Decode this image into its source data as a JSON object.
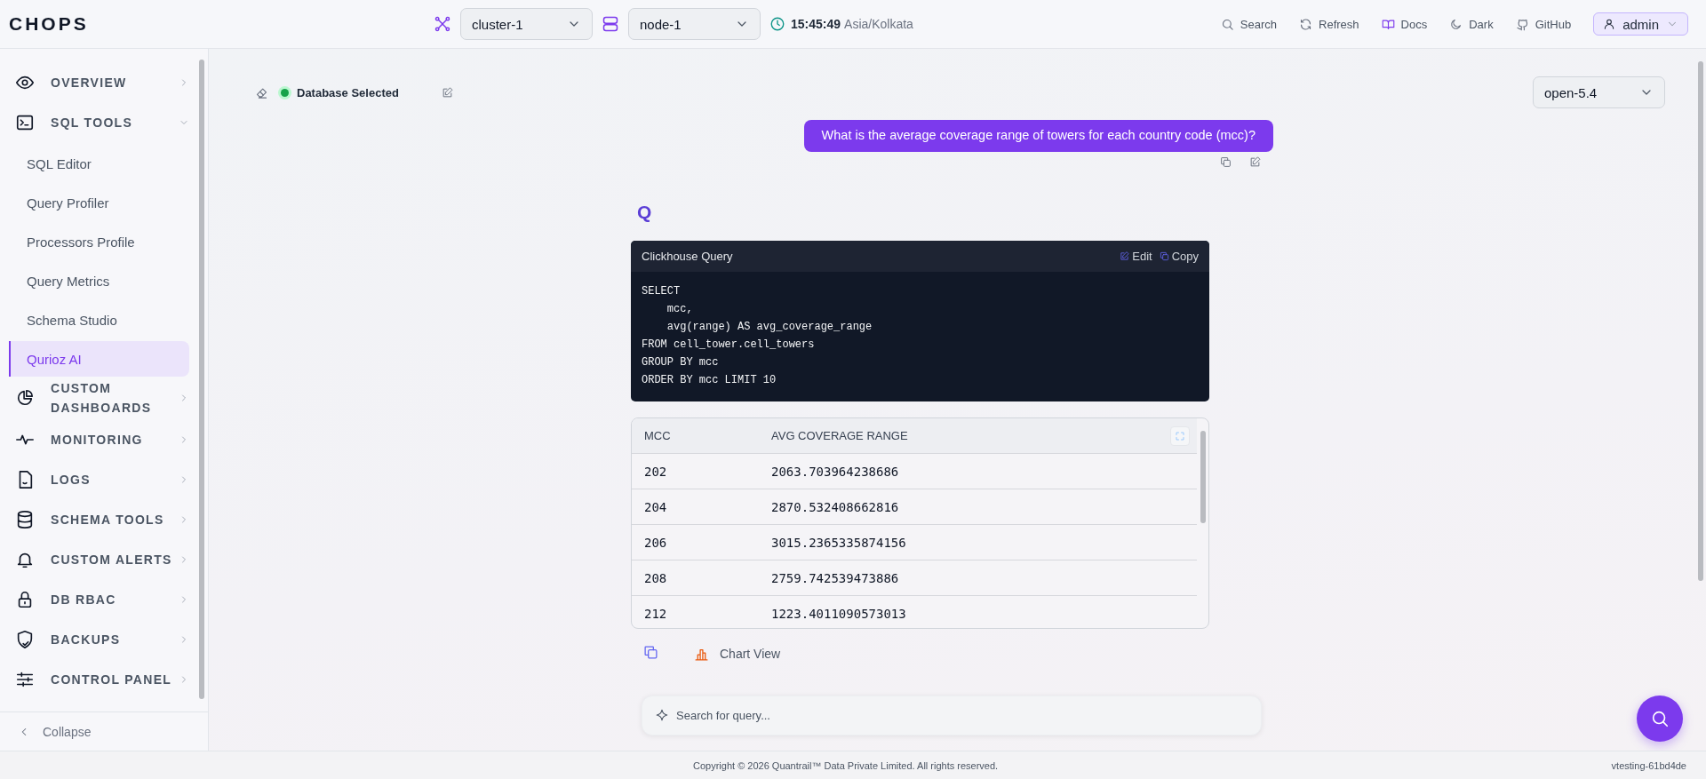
{
  "header": {
    "logo": "CHOPS",
    "cluster": "cluster-1",
    "node": "node-1",
    "time": "15:45:49",
    "timezone": "Asia/Kolkata",
    "actions": [
      {
        "kind": "search",
        "label": "Search"
      },
      {
        "kind": "refresh",
        "label": "Refresh"
      },
      {
        "kind": "docs",
        "label": "Docs"
      },
      {
        "kind": "theme",
        "label": "Dark"
      },
      {
        "kind": "github",
        "label": "GitHub"
      }
    ],
    "user": "admin"
  },
  "sidebar": {
    "items": [
      {
        "kind": "eye",
        "label": "OVERVIEW",
        "expanded": false
      },
      {
        "kind": "terminal",
        "label": "SQL TOOLS",
        "expanded": true,
        "children": [
          {
            "label": "SQL Editor",
            "selected": false
          },
          {
            "label": "Query Profiler",
            "selected": false
          },
          {
            "label": "Processors Profile",
            "selected": false
          },
          {
            "label": "Query Metrics",
            "selected": false
          },
          {
            "label": "Schema Studio",
            "selected": false
          },
          {
            "label": "Qurioz AI",
            "selected": true
          }
        ]
      },
      {
        "kind": "pie",
        "label": "CUSTOM DASHBOARDS",
        "expanded": false
      },
      {
        "kind": "pulse",
        "label": "MONITORING",
        "expanded": false
      },
      {
        "kind": "file",
        "label": "LOGS",
        "expanded": false
      },
      {
        "kind": "database",
        "label": "SCHEMA TOOLS",
        "expanded": false
      },
      {
        "kind": "bell",
        "label": "CUSTOM ALERTS",
        "expanded": false
      },
      {
        "kind": "lock",
        "label": "DB RBAC",
        "expanded": false
      },
      {
        "kind": "shield",
        "label": "BACKUPS",
        "expanded": false
      },
      {
        "kind": "sliders",
        "label": "CONTROL PANEL",
        "expanded": false
      }
    ],
    "collapse": "Collapse"
  },
  "chat": {
    "status": "Database Selected",
    "model": "open-5.4",
    "question": "What is the average coverage range of towers for each country code (mcc)?",
    "answer_mark": "Q",
    "query": {
      "title": "Clickhouse Query",
      "edit": "Edit",
      "copy": "Copy",
      "code": "SELECT\n    mcc,\n    avg(range) AS avg_coverage_range\nFROM cell_tower.cell_towers\nGROUP BY mcc\nORDER BY mcc LIMIT 10"
    },
    "table": {
      "columns": [
        "MCC",
        "AVG COVERAGE RANGE"
      ],
      "rows": [
        [
          "202",
          "2063.703964238686"
        ],
        [
          "204",
          "2870.532408662816"
        ],
        [
          "206",
          "3015.2365335874156"
        ],
        [
          "208",
          "2759.742539473886"
        ],
        [
          "212",
          "1223.4011090573013"
        ]
      ]
    },
    "chart_view": "Chart View",
    "search": {
      "placeholder": "Search for query..."
    }
  },
  "footer": {
    "copyright": "Copyright © 2026 Quantrail™ Data Private Limited. All rights reserved.",
    "version": "vtesting-61bd4de"
  }
}
